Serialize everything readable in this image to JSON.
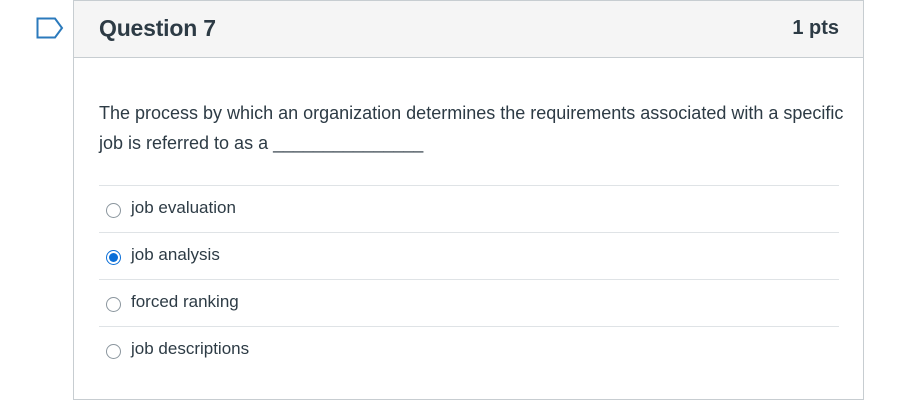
{
  "question": {
    "title": "Question 7",
    "points": "1 pts",
    "text": "The process by which an organization determines the requirements associated with a specific job is referred to as a _______________"
  },
  "answers": [
    {
      "label": "job evaluation",
      "selected": false
    },
    {
      "label": "job analysis",
      "selected": true
    },
    {
      "label": "forced ranking",
      "selected": false
    },
    {
      "label": "job descriptions",
      "selected": false
    }
  ],
  "colors": {
    "accent": "#0b6fd8",
    "flag": "#2b7abc",
    "header_bg": "#f5f5f5",
    "text": "#2d3b45"
  },
  "icons": {
    "flag": "bookmark-flag-icon"
  }
}
